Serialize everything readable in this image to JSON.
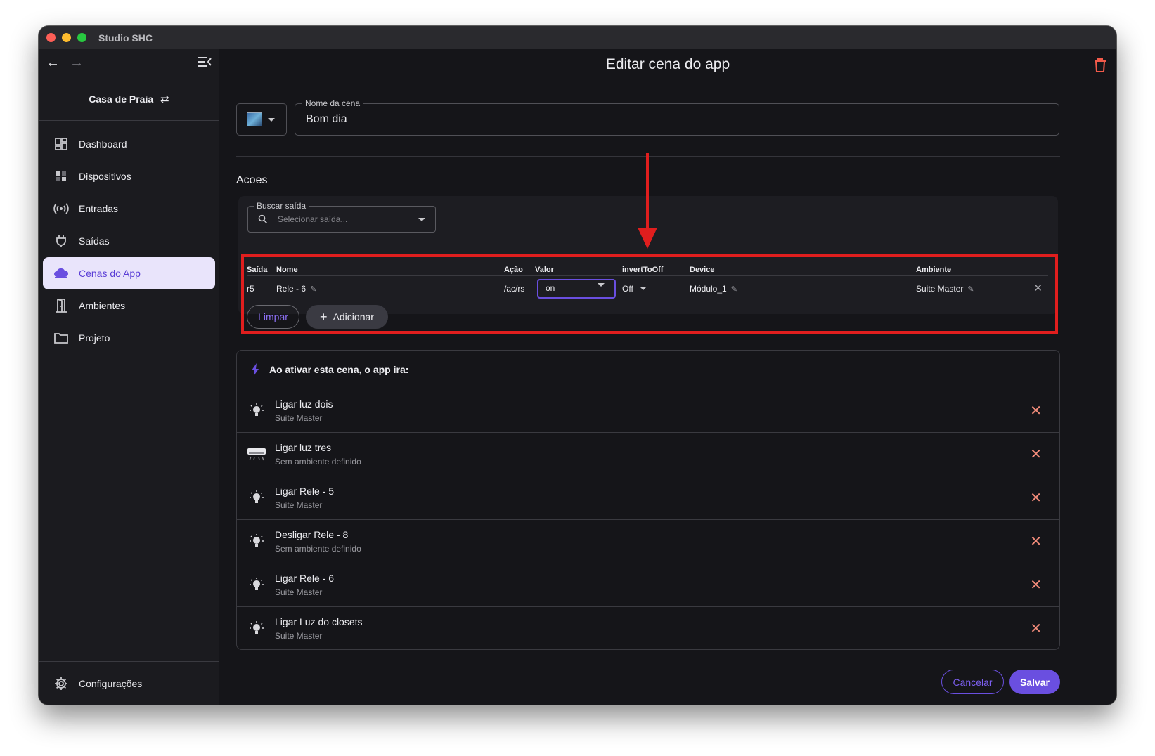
{
  "window": {
    "title": "Studio SHC"
  },
  "sidebar": {
    "project": "Casa de Praia",
    "items": [
      {
        "label": "Dashboard",
        "icon": "dashboard-icon"
      },
      {
        "label": "Dispositivos",
        "icon": "devices-icon"
      },
      {
        "label": "Entradas",
        "icon": "broadcast-icon"
      },
      {
        "label": "Saídas",
        "icon": "plug-icon"
      },
      {
        "label": "Cenas do App",
        "icon": "cloud-icon",
        "active": true
      },
      {
        "label": "Ambientes",
        "icon": "door-icon"
      },
      {
        "label": "Projeto",
        "icon": "folder-icon"
      }
    ],
    "settings_label": "Configurações"
  },
  "page": {
    "title": "Editar cena do app"
  },
  "scene_name": {
    "legend": "Nome da cena",
    "value": "Bom dia"
  },
  "acoes": {
    "title": "Acoes",
    "search": {
      "legend": "Buscar saída",
      "placeholder": "Selecionar saída..."
    },
    "columns": [
      "Saída",
      "Nome",
      "Ação",
      "Valor",
      "invertToOff",
      "Device",
      "Ambiente"
    ],
    "row": {
      "saida": "r5",
      "nome": "Rele - 6",
      "acao": "/ac/rs",
      "valor": "on",
      "invert": "Off",
      "device": "Módulo_1",
      "ambiente": "Suite Master"
    },
    "clear_label": "Limpar",
    "add_label": "Adicionar"
  },
  "scene_list": {
    "header": "Ao ativar esta cena, o app ira:",
    "items": [
      {
        "title": "Ligar luz dois",
        "subtitle": "Suite Master",
        "icon": "bulb-icon"
      },
      {
        "title": "Ligar luz tres",
        "subtitle": "Sem ambiente definido",
        "icon": "air-conditioner-icon"
      },
      {
        "title": "Ligar Rele - 5",
        "subtitle": "Suite Master",
        "icon": "bulb-icon"
      },
      {
        "title": "Desligar Rele - 8",
        "subtitle": "Sem ambiente definido",
        "icon": "bulb-icon"
      },
      {
        "title": "Ligar Rele - 6",
        "subtitle": "Suite Master",
        "icon": "bulb-icon"
      },
      {
        "title": "Ligar Luz do closets",
        "subtitle": "Suite Master",
        "icon": "bulb-icon"
      }
    ]
  },
  "footer": {
    "cancel_label": "Cancelar",
    "save_label": "Salvar"
  },
  "colors": {
    "accent": "#6a4fe0",
    "highlight": "#e01e1e",
    "remove": "#f28b7a"
  }
}
